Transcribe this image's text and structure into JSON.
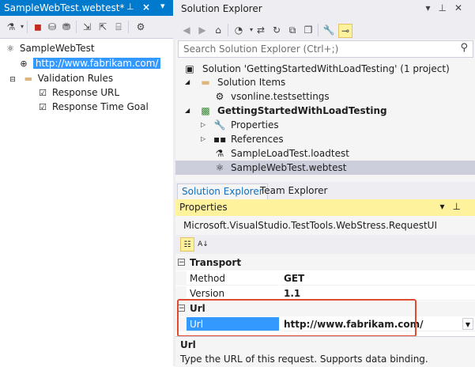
{
  "doc_tab": {
    "title": "SampleWebTest.webtest*",
    "pin_icon": "pin-icon",
    "close_icon": "close-icon"
  },
  "left_tree": {
    "root": "SampleWebTest",
    "request_url": "http://www.fabrikam.com/",
    "validation_rules": "Validation Rules",
    "rules": [
      "Response URL",
      "Response Time Goal"
    ]
  },
  "solution_explorer": {
    "title": "Solution Explorer",
    "search_placeholder": "Search Solution Explorer (Ctrl+;)",
    "items": {
      "solution": "Solution 'GettingStartedWithLoadTesting' (1 project)",
      "solution_items": "Solution Items",
      "testsettings": "vsonline.testsettings",
      "project": "GettingStartedWithLoadTesting",
      "properties": "Properties",
      "references": "References",
      "loadtest": "SampleLoadTest.loadtest",
      "webtest": "SampleWebTest.webtest"
    },
    "tabs": [
      "Solution Explorer",
      "Team Explorer"
    ]
  },
  "properties": {
    "title": "Properties",
    "object": "Microsoft.VisualStudio.TestTools.WebStress.RequestUI",
    "categories": {
      "transport": "Transport",
      "url": "Url"
    },
    "rows": {
      "method_name": "Method",
      "method_value": "GET",
      "version_name": "Version",
      "version_value": "1.1",
      "url_name": "Url",
      "url_value": "http://www.fabrikam.com/"
    },
    "description": {
      "title": "Url",
      "text": "Type the URL of this request. Supports data binding."
    }
  },
  "colors": {
    "accent": "#007acc",
    "selection": "#3399ff",
    "properties_header": "#fff29d",
    "highlight": "#e04a30"
  }
}
